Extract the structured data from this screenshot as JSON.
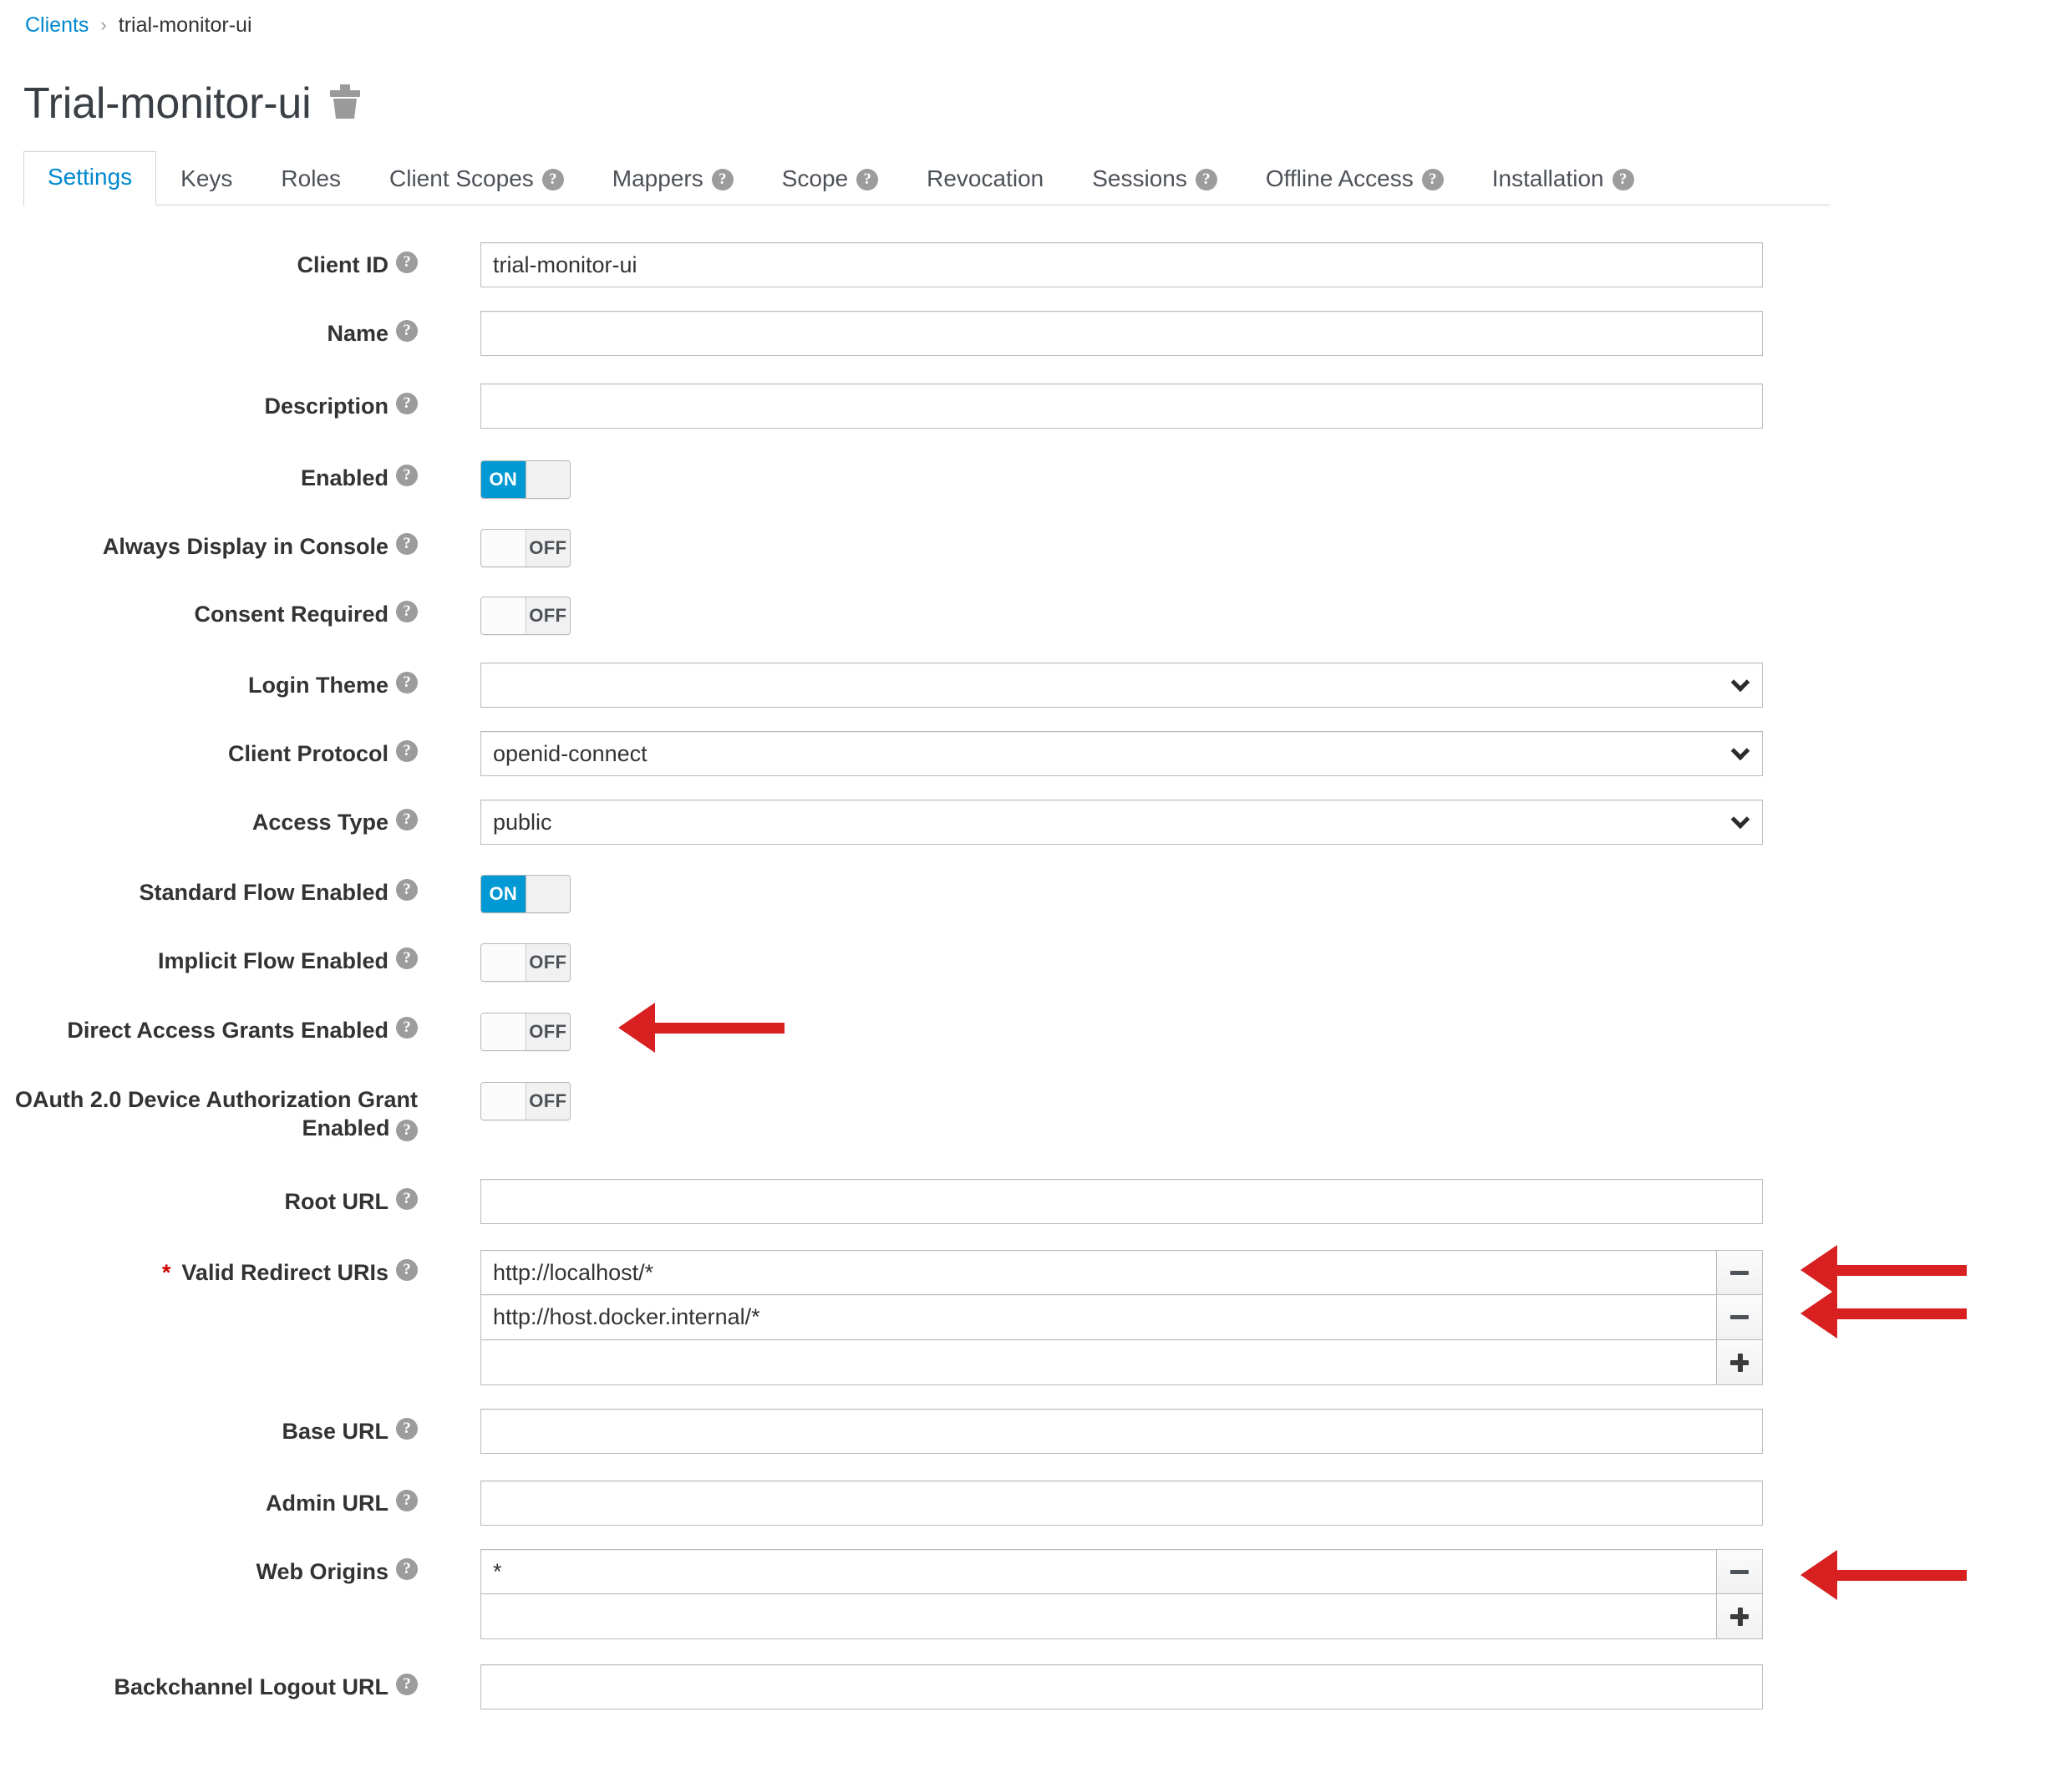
{
  "breadcrumb": {
    "root": "Clients",
    "separator": "›",
    "current": "trial-monitor-ui"
  },
  "header": {
    "title": "Trial-monitor-ui",
    "delete_icon": "trash-icon"
  },
  "tabs": [
    {
      "label": "Settings",
      "help": false,
      "active": true
    },
    {
      "label": "Keys",
      "help": false,
      "active": false
    },
    {
      "label": "Roles",
      "help": false,
      "active": false
    },
    {
      "label": "Client Scopes",
      "help": true,
      "active": false
    },
    {
      "label": "Mappers",
      "help": true,
      "active": false
    },
    {
      "label": "Scope",
      "help": true,
      "active": false
    },
    {
      "label": "Revocation",
      "help": false,
      "active": false
    },
    {
      "label": "Sessions",
      "help": true,
      "active": false
    },
    {
      "label": "Offline Access",
      "help": true,
      "active": false
    },
    {
      "label": "Installation",
      "help": true,
      "active": false
    }
  ],
  "form": {
    "client_id": {
      "label": "Client ID",
      "value": "trial-monitor-ui",
      "placeholder": ""
    },
    "name": {
      "label": "Name",
      "value": "",
      "placeholder": ""
    },
    "description": {
      "label": "Description",
      "value": "",
      "placeholder": ""
    },
    "enabled": {
      "label": "Enabled",
      "state": "ON"
    },
    "always_display": {
      "label": "Always Display in Console",
      "state": "OFF"
    },
    "consent_required": {
      "label": "Consent Required",
      "state": "OFF"
    },
    "login_theme": {
      "label": "Login Theme",
      "value": ""
    },
    "client_protocol": {
      "label": "Client Protocol",
      "value": "openid-connect"
    },
    "access_type": {
      "label": "Access Type",
      "value": "public"
    },
    "standard_flow": {
      "label": "Standard Flow Enabled",
      "state": "ON"
    },
    "implicit_flow": {
      "label": "Implicit Flow Enabled",
      "state": "OFF"
    },
    "direct_access": {
      "label": "Direct Access Grants Enabled",
      "state": "OFF"
    },
    "device_grant": {
      "label": "OAuth 2.0 Device Authorization Grant Enabled",
      "state": "OFF"
    },
    "root_url": {
      "label": "Root URL",
      "value": ""
    },
    "valid_redirect_uris": {
      "label": "Valid Redirect URIs",
      "required": "*",
      "values": [
        "http://localhost/*",
        "http://host.docker.internal/*",
        ""
      ]
    },
    "base_url": {
      "label": "Base URL",
      "value": ""
    },
    "admin_url": {
      "label": "Admin URL",
      "value": ""
    },
    "web_origins": {
      "label": "Web Origins",
      "values": [
        "*",
        ""
      ]
    },
    "backchannel_logout_url": {
      "label": "Backchannel Logout URL",
      "value": ""
    }
  },
  "toggle_labels": {
    "on": "ON",
    "off": "OFF"
  },
  "row_buttons": {
    "remove": "minus-button",
    "add": "plus-button"
  },
  "colors": {
    "link": "#0088ce",
    "toggle_on": "#0099d3",
    "annotation_arrow": "#d82020",
    "required_asterisk": "#cc0000",
    "help_icon": "#9c9c9c"
  },
  "annotations": [
    {
      "name": "arrow-direct-access-grants",
      "target": "direct_access"
    },
    {
      "name": "arrow-redirect-uri-1",
      "target": "valid_redirect_uris.0"
    },
    {
      "name": "arrow-redirect-uri-2",
      "target": "valid_redirect_uris.1"
    },
    {
      "name": "arrow-web-origins",
      "target": "web_origins.0"
    }
  ]
}
